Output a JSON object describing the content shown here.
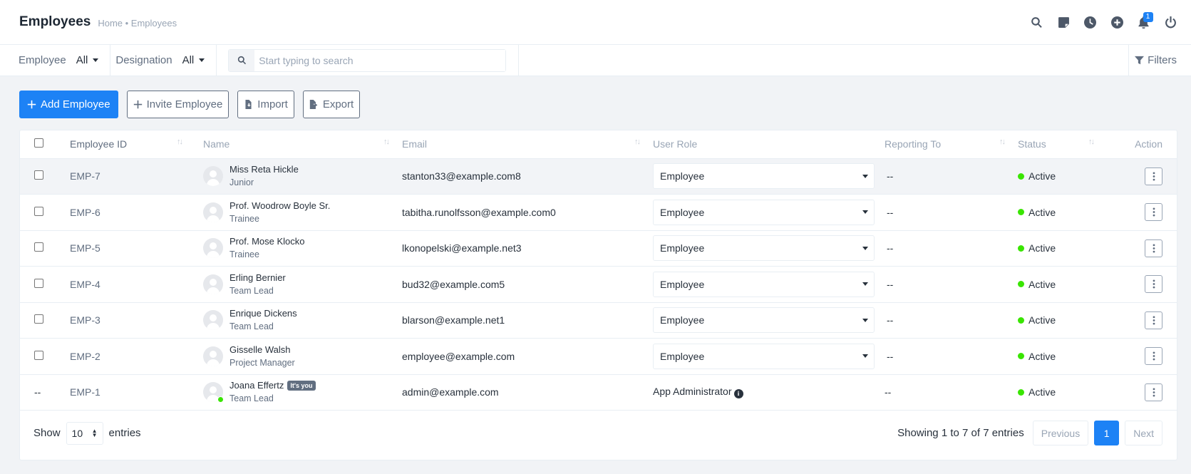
{
  "header": {
    "title": "Employees",
    "breadcrumb": "Home • Employees",
    "notification_count": "1"
  },
  "filters": {
    "employee_label": "Employee",
    "employee_value": "All",
    "designation_label": "Designation",
    "designation_value": "All",
    "search_placeholder": "Start typing to search",
    "filters_label": "Filters"
  },
  "toolbar": {
    "add_label": "Add Employee",
    "invite_label": "Invite Employee",
    "import_label": "Import",
    "export_label": "Export"
  },
  "table": {
    "columns": [
      "Employee ID",
      "Name",
      "Email",
      "User Role",
      "Reporting To",
      "Status",
      "Action"
    ],
    "rows": [
      {
        "id": "EMP-7",
        "name": "Miss Reta Hickle",
        "designation": "Junior",
        "email": "stanton33@example.com8",
        "role": "Employee",
        "reporting": "--",
        "status": "Active"
      },
      {
        "id": "EMP-6",
        "name": "Prof. Woodrow Boyle Sr.",
        "designation": "Trainee",
        "email": "tabitha.runolfsson@example.com0",
        "role": "Employee",
        "reporting": "--",
        "status": "Active"
      },
      {
        "id": "EMP-5",
        "name": "Prof. Mose Klocko",
        "designation": "Trainee",
        "email": "lkonopelski@example.net3",
        "role": "Employee",
        "reporting": "--",
        "status": "Active"
      },
      {
        "id": "EMP-4",
        "name": "Erling Bernier",
        "designation": "Team Lead",
        "email": "bud32@example.com5",
        "role": "Employee",
        "reporting": "--",
        "status": "Active"
      },
      {
        "id": "EMP-3",
        "name": "Enrique Dickens",
        "designation": "Team Lead",
        "email": "blarson@example.net1",
        "role": "Employee",
        "reporting": "--",
        "status": "Active"
      },
      {
        "id": "EMP-2",
        "name": "Gisselle Walsh",
        "designation": "Project Manager",
        "email": "employee@example.com",
        "role": "Employee",
        "reporting": "--",
        "status": "Active"
      }
    ],
    "self_row": {
      "check": "--",
      "id": "EMP-1",
      "name": "Joana Effertz",
      "badge": "It's you",
      "designation": "Team Lead",
      "email": "admin@example.com",
      "role": "App Administrator",
      "reporting": "--",
      "status": "Active"
    }
  },
  "footer": {
    "show_label": "Show",
    "page_length": "10",
    "entries_label": "entries",
    "info": "Showing 1 to 7 of 7 entries",
    "previous": "Previous",
    "current_page": "1",
    "next": "Next"
  },
  "colors": {
    "primary": "#1d82f5",
    "status_active": "#39e500"
  }
}
